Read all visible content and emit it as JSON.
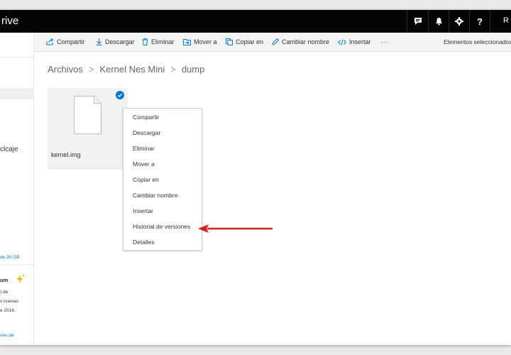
{
  "app": {
    "title": "rive",
    "user_abbr": "R"
  },
  "topbar": {
    "icons": [
      "feedback-icon",
      "bell-icon",
      "gear-icon",
      "help-icon"
    ],
    "help_glyph": "?"
  },
  "commands": [
    {
      "label": "Compartir",
      "icon": "share-icon"
    },
    {
      "label": "Descargar",
      "icon": "download-icon"
    },
    {
      "label": "Eliminar",
      "icon": "trash-icon"
    },
    {
      "label": "Mover a",
      "icon": "move-icon"
    },
    {
      "label": "Copiar en",
      "icon": "copy-icon"
    },
    {
      "label": "Cambiar nombre",
      "icon": "rename-icon"
    },
    {
      "label": "Insertar",
      "icon": "embed-icon"
    },
    {
      "label": "···",
      "icon": "more-icon"
    }
  ],
  "selection_info": "Elementos seleccionados",
  "sidebar": {
    "partial_item": "clcaje",
    "storage_link": "de 30 GB",
    "premium_title": "um",
    "premium_lines": [
      ") de",
      "s nuevas",
      "e 2016."
    ],
    "bottom_link": "nes de"
  },
  "breadcrumb": [
    "Archivos",
    "Kernel Nes Mini",
    "dump"
  ],
  "breadcrumb_separator": ">",
  "file": {
    "name": "kernel.img",
    "selected": true
  },
  "context_menu": [
    "Compartir",
    "Descargar",
    "Eliminar",
    "Mover a",
    "Copiar en",
    "Cambiar nombre",
    "Insertar",
    "Historial de versiones",
    "Detalles"
  ],
  "colors": {
    "accent": "#0078d4",
    "topbar": "#050505",
    "annotation_arrow": "#d9201f"
  }
}
